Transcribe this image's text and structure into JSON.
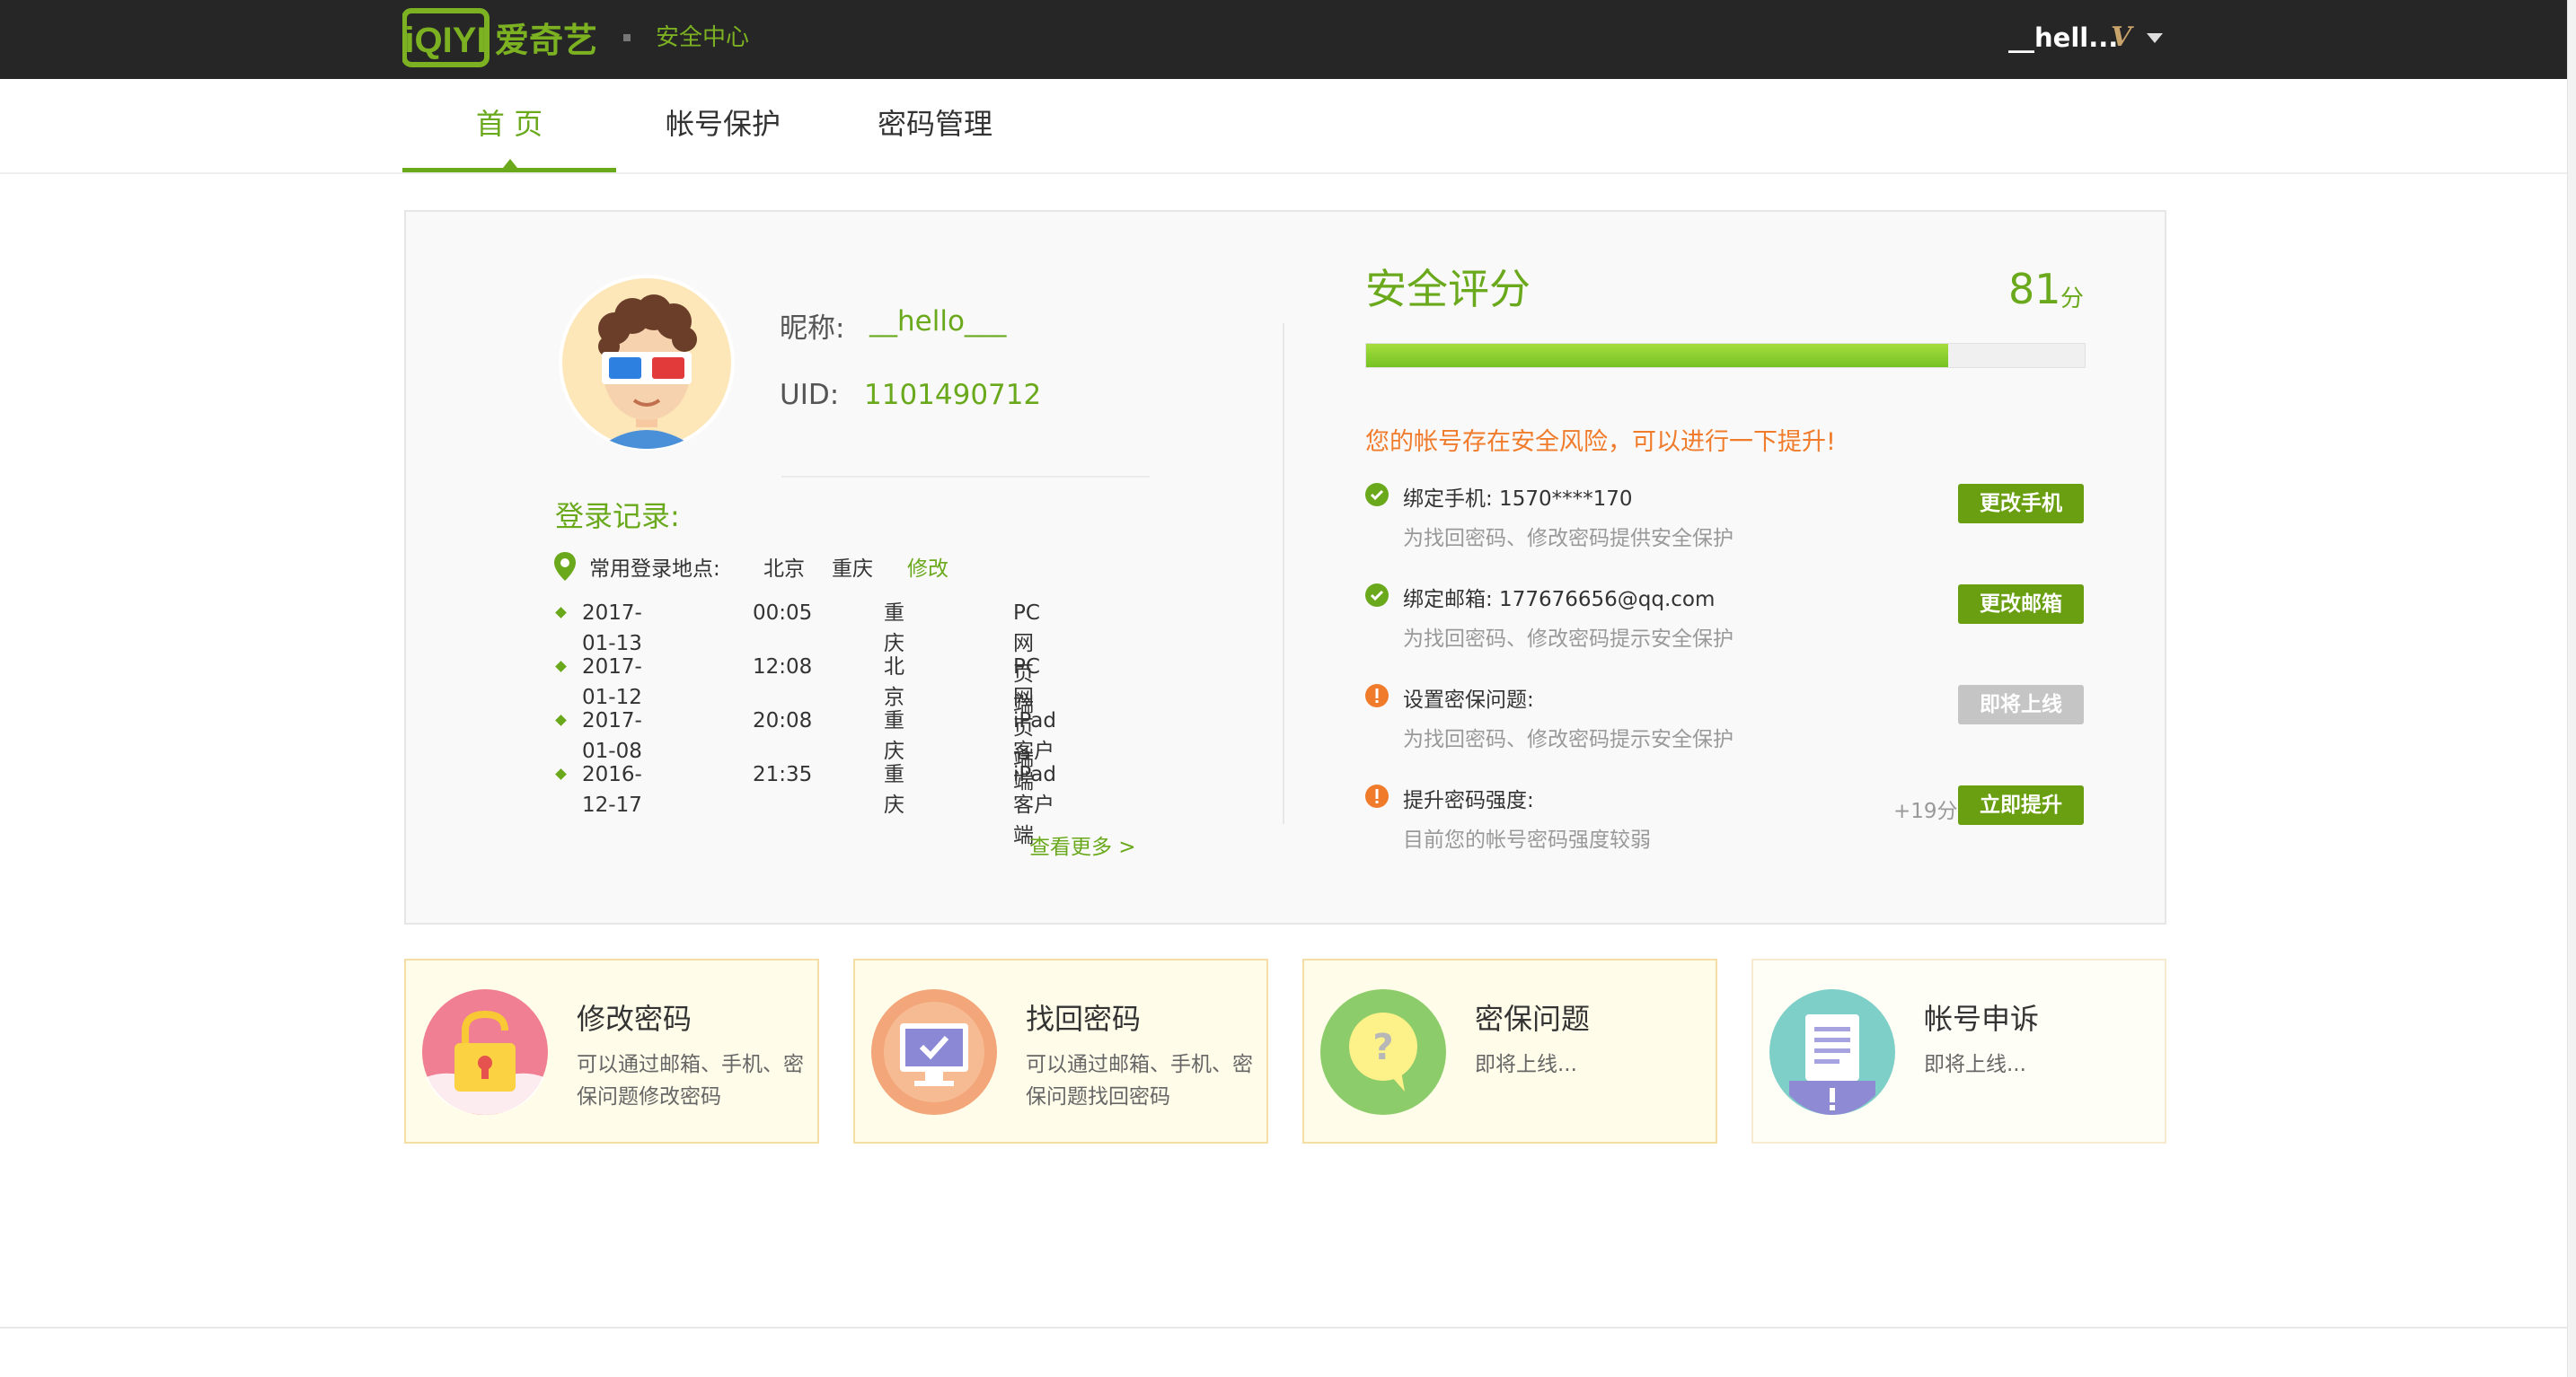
{
  "header": {
    "site_name": "安全中心",
    "user_name": "__hell...",
    "vip_badge": "V"
  },
  "nav": {
    "tabs": [
      {
        "label": "首 页",
        "active": true
      },
      {
        "label": "帐号保护",
        "active": false
      },
      {
        "label": "密码管理",
        "active": false
      }
    ]
  },
  "profile": {
    "nickname_label": "昵称:",
    "nickname": "__hello___",
    "uid_label": "UID:",
    "uid": "1101490712"
  },
  "login_records": {
    "title": "登录记录:",
    "common_location_label": "常用登录地点:",
    "common_locations": [
      "北京",
      "重庆"
    ],
    "edit_label": "修改",
    "records": [
      {
        "date": "2017-01-13",
        "time": "00:05",
        "city": "重庆",
        "device": "PC网页端"
      },
      {
        "date": "2017-01-12",
        "time": "12:08",
        "city": "北京",
        "device": "PC网页端"
      },
      {
        "date": "2017-01-08",
        "time": "20:08",
        "city": "重庆",
        "device": "iPad客户端"
      },
      {
        "date": "2016-12-17",
        "time": "21:35",
        "city": "重庆",
        "device": "iPad客户端"
      }
    ],
    "see_more": "查看更多 >"
  },
  "security": {
    "title": "安全评分",
    "score": "81",
    "score_unit": "分",
    "score_fraction": 0.81,
    "risk_text": "您的帐号存在安全风险，可以进行一下提升!",
    "items": [
      {
        "status": "ok",
        "title": "绑定手机:  1570****170",
        "desc": "为找回密码、修改密码提供安全保护",
        "button": "更改手机",
        "enabled": true
      },
      {
        "status": "ok",
        "title": "绑定邮箱:  177676656@qq.com",
        "desc": "为找回密码、修改密码提示安全保护",
        "button": "更改邮箱",
        "enabled": true
      },
      {
        "status": "warn",
        "title": "设置密保问题:",
        "desc": "为找回密码、修改密码提示安全保护",
        "button": "即将上线",
        "enabled": false
      },
      {
        "status": "warn",
        "title": "提升密码强度:",
        "desc": "目前您的帐号密码强度较弱",
        "button": "立即提升",
        "enabled": true
      }
    ],
    "bonus": "+19分"
  },
  "cards": [
    {
      "title": "修改密码",
      "desc": "可以通过邮箱、手机、密保问题修改密码",
      "icon": "unlock-icon"
    },
    {
      "title": "找回密码",
      "desc": "可以通过邮箱、手机、密保问题找回密码",
      "icon": "monitor-check-icon"
    },
    {
      "title": "密保问题",
      "desc": "即将上线...",
      "icon": "question-bubble-icon"
    },
    {
      "title": "帐号申诉",
      "desc": "即将上线...",
      "icon": "document-icon"
    }
  ],
  "colors": {
    "accent_green": "#6aa91c",
    "warning_orange": "#f07b2b",
    "topbar": "#262626"
  }
}
